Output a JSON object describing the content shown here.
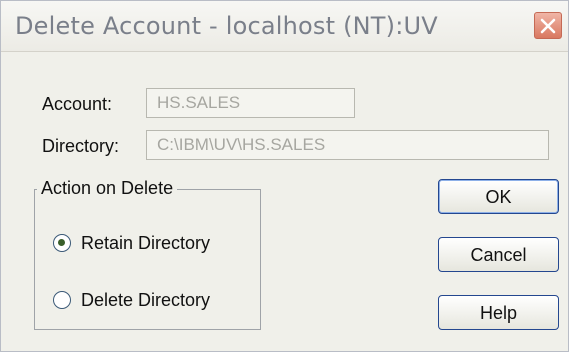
{
  "window": {
    "title": "Delete Account - localhost (NT):UV"
  },
  "form": {
    "account_label": "Account:",
    "account_value": "HS.SALES",
    "directory_label": "Directory:",
    "directory_value": "C:\\IBM\\UV\\HS.SALES"
  },
  "action_group": {
    "legend": "Action on Delete",
    "options": [
      {
        "label": "Retain Directory",
        "selected": true
      },
      {
        "label": "Delete Directory",
        "selected": false
      }
    ]
  },
  "buttons": {
    "ok": "OK",
    "cancel": "Cancel",
    "help": "Help"
  },
  "icons": {
    "close": "close-icon"
  },
  "colors": {
    "title_text": "#7a7f8a",
    "close_button": "#d97860",
    "button_border": "#24478f",
    "disabled_text": "#a6a6a0"
  }
}
